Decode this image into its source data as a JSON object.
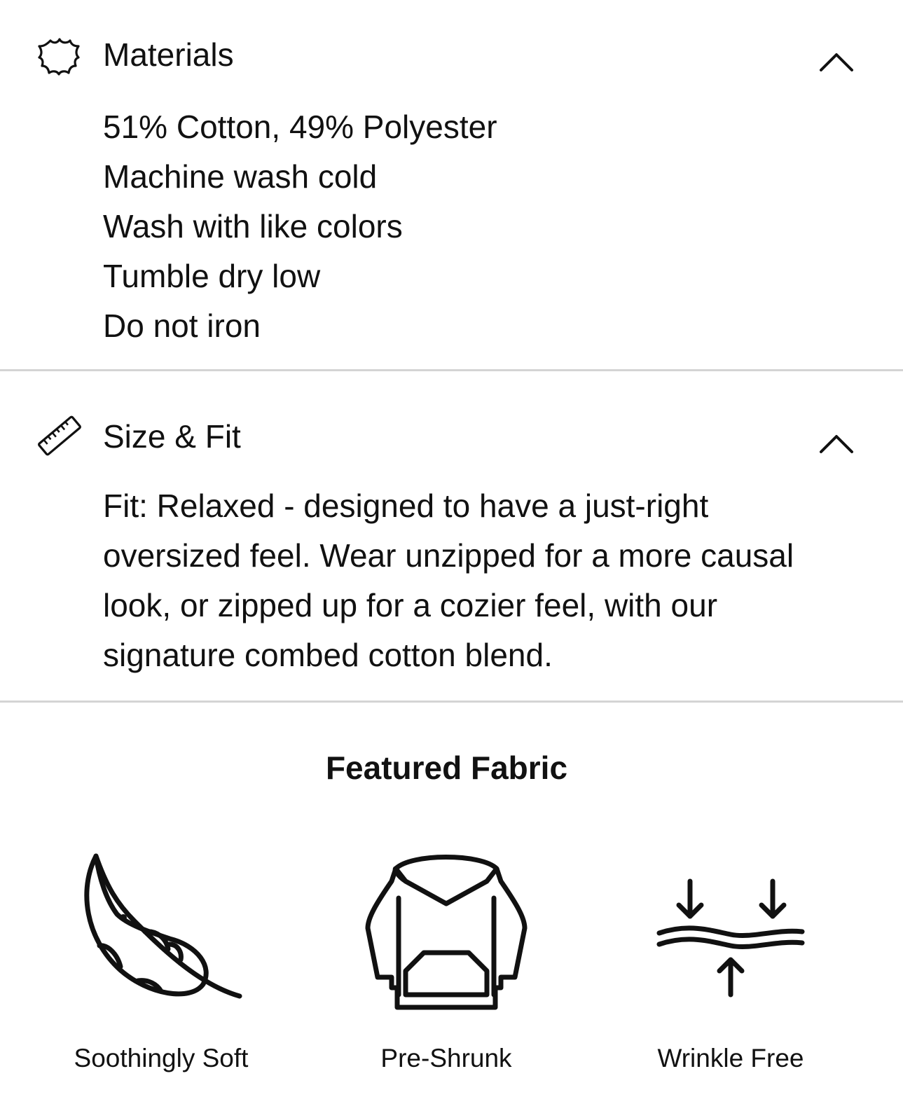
{
  "materials": {
    "icon": "leather-hide-icon",
    "title": "Materials",
    "items": [
      "51% Cotton, 49% Polyester",
      "Machine wash cold",
      "Wash with like colors",
      "Tumble dry low",
      "Do not iron"
    ],
    "toggle_icon": "chevron-up-icon"
  },
  "size_fit": {
    "icon": "ruler-icon",
    "title": "Size & Fit",
    "description": "Fit: Relaxed - designed to have a just-right oversized feel. Wear unzipped for a more causal look, or zipped up for a cozier feel, with our signature combed cotton blend.",
    "toggle_icon": "chevron-up-icon"
  },
  "featured_fabric": {
    "title": "Featured Fabric",
    "features": [
      {
        "icon": "feather-icon",
        "label": "Soothingly Soft"
      },
      {
        "icon": "hoodie-icon",
        "label": "Pre-Shrunk"
      },
      {
        "icon": "wrinkle-free-icon",
        "label": "Wrinkle Free"
      }
    ]
  },
  "colors": {
    "text": "#111111",
    "divider": "#d4d4d4",
    "background": "#ffffff"
  }
}
